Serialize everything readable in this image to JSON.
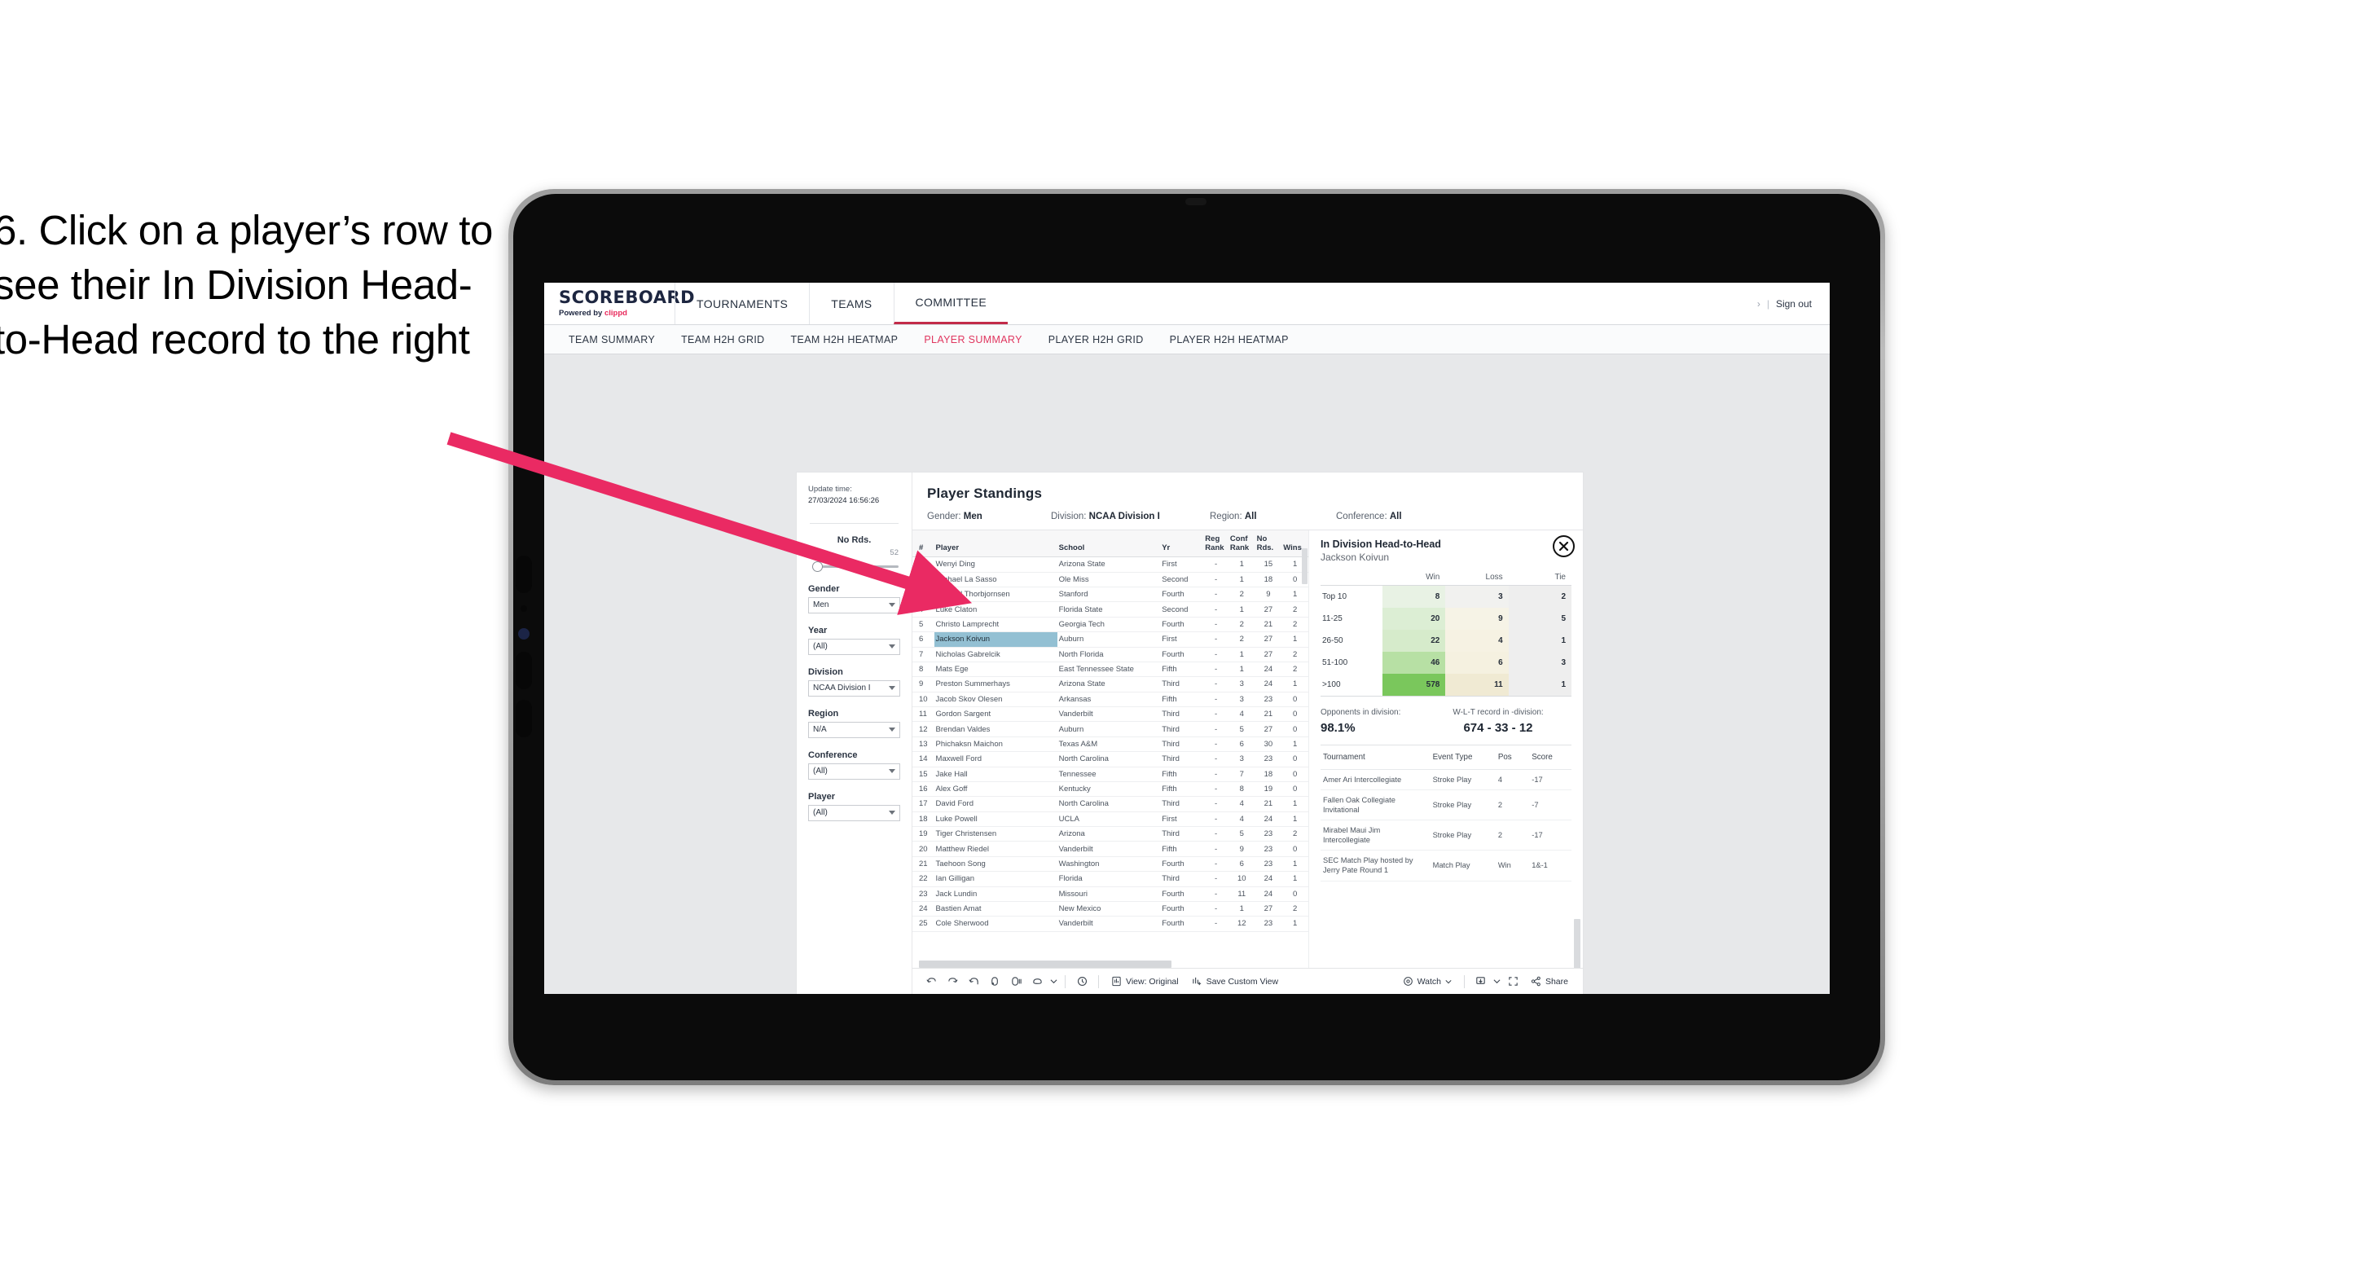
{
  "instruction": "6. Click on a player’s row to see their In Division Head-to-Head record to the right",
  "app": {
    "brand": {
      "title": "SCOREBOARD",
      "powered_prefix": "Powered by ",
      "powered_name": "clippd"
    },
    "nav": [
      {
        "label": "TOURNAMENTS",
        "active": false
      },
      {
        "label": "TEAMS",
        "active": false
      },
      {
        "label": "COMMITTEE",
        "active": true
      }
    ],
    "header_right": {
      "dot": "›",
      "sep": "|",
      "signout": "Sign out"
    },
    "subnav": [
      {
        "label": "TEAM SUMMARY",
        "active": false
      },
      {
        "label": "TEAM H2H GRID",
        "active": false
      },
      {
        "label": "TEAM H2H HEATMAP",
        "active": false
      },
      {
        "label": "PLAYER SUMMARY",
        "active": true
      },
      {
        "label": "PLAYER H2H GRID",
        "active": false
      },
      {
        "label": "PLAYER H2H HEATMAP",
        "active": false
      }
    ]
  },
  "rail": {
    "update_label": "Update time:",
    "update_value": "27/03/2024 16:56:26",
    "slider": {
      "title": "No Rds.",
      "min": "6",
      "max": "52"
    },
    "filters": [
      {
        "label": "Gender",
        "value": "Men"
      },
      {
        "label": "Year",
        "value": "(All)"
      },
      {
        "label": "Division",
        "value": "NCAA Division I"
      },
      {
        "label": "Region",
        "value": "N/A"
      },
      {
        "label": "Conference",
        "value": "(All)"
      },
      {
        "label": "Player",
        "value": "(All)"
      }
    ]
  },
  "standings": {
    "title": "Player Standings",
    "meta": [
      {
        "key": "Gender: ",
        "value": "Men"
      },
      {
        "key": "Division: ",
        "value": "NCAA Division I"
      },
      {
        "key": "Region: ",
        "value": "All"
      },
      {
        "key": "Conference: ",
        "value": "All"
      }
    ],
    "columns": [
      "#",
      "Player",
      "School",
      "Yr",
      "Reg Rank",
      "Conf Rank",
      "No Rds.",
      "Wins"
    ],
    "rows": [
      {
        "n": "1",
        "player": "Wenyi Ding",
        "school": "Arizona State",
        "yr": "First",
        "reg": "-",
        "conf": "1",
        "rds": "15",
        "wins": "1",
        "selected": false
      },
      {
        "n": "2",
        "player": "Michael La Sasso",
        "school": "Ole Miss",
        "yr": "Second",
        "reg": "-",
        "conf": "1",
        "rds": "18",
        "wins": "0",
        "selected": false
      },
      {
        "n": "3",
        "player": "Michael Thorbjornsen",
        "school": "Stanford",
        "yr": "Fourth",
        "reg": "-",
        "conf": "2",
        "rds": "9",
        "wins": "1",
        "selected": false
      },
      {
        "n": "4",
        "player": "Luke Claton",
        "school": "Florida State",
        "yr": "Second",
        "reg": "-",
        "conf": "1",
        "rds": "27",
        "wins": "2",
        "selected": false
      },
      {
        "n": "5",
        "player": "Christo Lamprecht",
        "school": "Georgia Tech",
        "yr": "Fourth",
        "reg": "-",
        "conf": "2",
        "rds": "21",
        "wins": "2",
        "selected": false
      },
      {
        "n": "6",
        "player": "Jackson Koivun",
        "school": "Auburn",
        "yr": "First",
        "reg": "-",
        "conf": "2",
        "rds": "27",
        "wins": "1",
        "selected": true
      },
      {
        "n": "7",
        "player": "Nicholas Gabrelcik",
        "school": "North Florida",
        "yr": "Fourth",
        "reg": "-",
        "conf": "1",
        "rds": "27",
        "wins": "2",
        "selected": false
      },
      {
        "n": "8",
        "player": "Mats Ege",
        "school": "East Tennessee State",
        "yr": "Fifth",
        "reg": "-",
        "conf": "1",
        "rds": "24",
        "wins": "2",
        "selected": false
      },
      {
        "n": "9",
        "player": "Preston Summerhays",
        "school": "Arizona State",
        "yr": "Third",
        "reg": "-",
        "conf": "3",
        "rds": "24",
        "wins": "1",
        "selected": false
      },
      {
        "n": "10",
        "player": "Jacob Skov Olesen",
        "school": "Arkansas",
        "yr": "Fifth",
        "reg": "-",
        "conf": "3",
        "rds": "23",
        "wins": "0",
        "selected": false
      },
      {
        "n": "11",
        "player": "Gordon Sargent",
        "school": "Vanderbilt",
        "yr": "Third",
        "reg": "-",
        "conf": "4",
        "rds": "21",
        "wins": "0",
        "selected": false
      },
      {
        "n": "12",
        "player": "Brendan Valdes",
        "school": "Auburn",
        "yr": "Third",
        "reg": "-",
        "conf": "5",
        "rds": "27",
        "wins": "0",
        "selected": false
      },
      {
        "n": "13",
        "player": "Phichaksn Maichon",
        "school": "Texas A&M",
        "yr": "Third",
        "reg": "-",
        "conf": "6",
        "rds": "30",
        "wins": "1",
        "selected": false
      },
      {
        "n": "14",
        "player": "Maxwell Ford",
        "school": "North Carolina",
        "yr": "Third",
        "reg": "-",
        "conf": "3",
        "rds": "23",
        "wins": "0",
        "selected": false
      },
      {
        "n": "15",
        "player": "Jake Hall",
        "school": "Tennessee",
        "yr": "Fifth",
        "reg": "-",
        "conf": "7",
        "rds": "18",
        "wins": "0",
        "selected": false
      },
      {
        "n": "16",
        "player": "Alex Goff",
        "school": "Kentucky",
        "yr": "Fifth",
        "reg": "-",
        "conf": "8",
        "rds": "19",
        "wins": "0",
        "selected": false
      },
      {
        "n": "17",
        "player": "David Ford",
        "school": "North Carolina",
        "yr": "Third",
        "reg": "-",
        "conf": "4",
        "rds": "21",
        "wins": "1",
        "selected": false
      },
      {
        "n": "18",
        "player": "Luke Powell",
        "school": "UCLA",
        "yr": "First",
        "reg": "-",
        "conf": "4",
        "rds": "24",
        "wins": "1",
        "selected": false
      },
      {
        "n": "19",
        "player": "Tiger Christensen",
        "school": "Arizona",
        "yr": "Third",
        "reg": "-",
        "conf": "5",
        "rds": "23",
        "wins": "2",
        "selected": false
      },
      {
        "n": "20",
        "player": "Matthew Riedel",
        "school": "Vanderbilt",
        "yr": "Fifth",
        "reg": "-",
        "conf": "9",
        "rds": "23",
        "wins": "0",
        "selected": false
      },
      {
        "n": "21",
        "player": "Taehoon Song",
        "school": "Washington",
        "yr": "Fourth",
        "reg": "-",
        "conf": "6",
        "rds": "23",
        "wins": "1",
        "selected": false
      },
      {
        "n": "22",
        "player": "Ian Gilligan",
        "school": "Florida",
        "yr": "Third",
        "reg": "-",
        "conf": "10",
        "rds": "24",
        "wins": "1",
        "selected": false
      },
      {
        "n": "23",
        "player": "Jack Lundin",
        "school": "Missouri",
        "yr": "Fourth",
        "reg": "-",
        "conf": "11",
        "rds": "24",
        "wins": "0",
        "selected": false
      },
      {
        "n": "24",
        "player": "Bastien Amat",
        "school": "New Mexico",
        "yr": "Fourth",
        "reg": "-",
        "conf": "1",
        "rds": "27",
        "wins": "2",
        "selected": false
      },
      {
        "n": "25",
        "player": "Cole Sherwood",
        "school": "Vanderbilt",
        "yr": "Fourth",
        "reg": "-",
        "conf": "12",
        "rds": "23",
        "wins": "1",
        "selected": false
      }
    ]
  },
  "detail": {
    "title": "In Division Head-to-Head",
    "subtitle": "Jackson Koivun",
    "close_icon": "close-icon",
    "heatmap": {
      "columns": [
        "Win",
        "Loss",
        "Tie"
      ],
      "rows": [
        {
          "label": "Top 10",
          "win": "8",
          "loss": "3",
          "tie": "2",
          "win_color": "#e8f2e4",
          "loss_color": "#f1f1ef",
          "tie_color": "#eeeeee"
        },
        {
          "label": "11-25",
          "win": "20",
          "loss": "9",
          "tie": "5",
          "win_color": "#dceed4",
          "loss_color": "#f6f3e6",
          "tie_color": "#eeeeee"
        },
        {
          "label": "26-50",
          "win": "22",
          "loss": "4",
          "tie": "1",
          "win_color": "#d6ebcb",
          "loss_color": "#f6f2e3",
          "tie_color": "#eeeeee"
        },
        {
          "label": "51-100",
          "win": "46",
          "loss": "6",
          "tie": "3",
          "win_color": "#b7e0a4",
          "loss_color": "#f5f1e0",
          "tie_color": "#eeeeee"
        },
        {
          "label": ">100",
          "win": "578",
          "loss": "11",
          "tie": "1",
          "win_color": "#7ac75c",
          "loss_color": "#f0ead3",
          "tie_color": "#eeeeee"
        }
      ]
    },
    "stats": [
      {
        "key": "Opponents in division:",
        "value": "98.1%"
      },
      {
        "key": "W-L-T record in -division:",
        "value": "674 - 33 - 12"
      }
    ],
    "tournaments": {
      "columns": [
        "Tournament",
        "Event Type",
        "Pos",
        "Score"
      ],
      "rows": [
        {
          "tournament": "Amer Ari Intercollegiate",
          "type": "Stroke Play",
          "pos": "4",
          "score": "-17"
        },
        {
          "tournament": "Fallen Oak Collegiate Invitational",
          "type": "Stroke Play",
          "pos": "2",
          "score": "-7"
        },
        {
          "tournament": "Mirabel Maui Jim Intercollegiate",
          "type": "Stroke Play",
          "pos": "2",
          "score": "-17"
        },
        {
          "tournament": "SEC Match Play hosted by Jerry Pate Round 1",
          "type": "Match Play",
          "pos": "Win",
          "score": "1&-1"
        }
      ]
    }
  },
  "toolbar": {
    "view_original": "View: Original",
    "save_custom_view": "Save Custom View",
    "watch": "Watch",
    "share": "Share"
  }
}
